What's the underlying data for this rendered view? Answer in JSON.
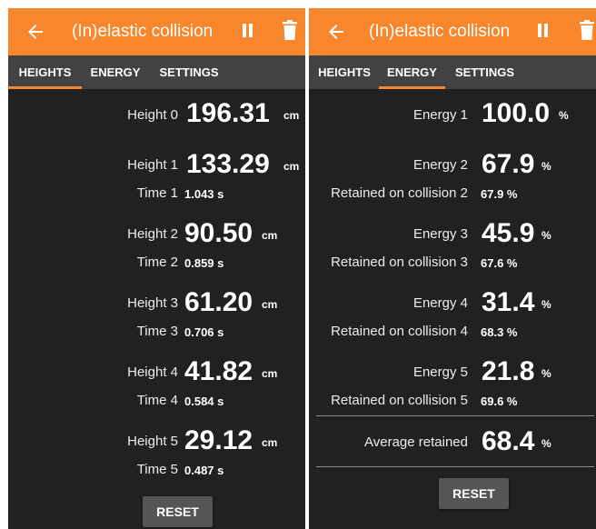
{
  "app": {
    "title": "(In)elastic collision",
    "icons": [
      "back-arrow-icon",
      "pause-icon",
      "trash-icon"
    ],
    "accent": "#f7862d",
    "background": "#212121"
  },
  "tabs": [
    "HEIGHTS",
    "ENERGY",
    "SETTINGS"
  ],
  "heights": {
    "rows": [
      {
        "label": "Height 0",
        "value": "196.31",
        "unit": "cm"
      },
      {
        "label": "Height 1",
        "value": "133.29",
        "unit": "cm",
        "time_label": "Time 1",
        "time": "1.043 s"
      },
      {
        "label": "Height 2",
        "value": "90.50",
        "unit": "cm",
        "time_label": "Time 2",
        "time": "0.859 s"
      },
      {
        "label": "Height 3",
        "value": "61.20",
        "unit": "cm",
        "time_label": "Time 3",
        "time": "0.706 s"
      },
      {
        "label": "Height 4",
        "value": "41.82",
        "unit": "cm",
        "time_label": "Time 4",
        "time": "0.584 s"
      },
      {
        "label": "Height 5",
        "value": "29.12",
        "unit": "cm",
        "time_label": "Time 5",
        "time": "0.487 s"
      }
    ],
    "reset_label": "RESET"
  },
  "energy": {
    "rows": [
      {
        "label": "Energy 1",
        "value": "100.0",
        "unit": "%"
      },
      {
        "label": "Energy 2",
        "value": "67.9",
        "unit": "%",
        "retained_label": "Retained on collision 2",
        "retained": "67.9 %"
      },
      {
        "label": "Energy 3",
        "value": "45.9",
        "unit": "%",
        "retained_label": "Retained on collision 3",
        "retained": "67.6 %"
      },
      {
        "label": "Energy 4",
        "value": "31.4",
        "unit": "%",
        "retained_label": "Retained on collision 4",
        "retained": "68.3 %"
      },
      {
        "label": "Energy 5",
        "value": "21.8",
        "unit": "%",
        "retained_label": "Retained on collision 5",
        "retained": "69.6 %"
      }
    ],
    "average_label": "Average retained",
    "average_value": "68.4",
    "average_unit": "%",
    "reset_label": "RESET"
  }
}
